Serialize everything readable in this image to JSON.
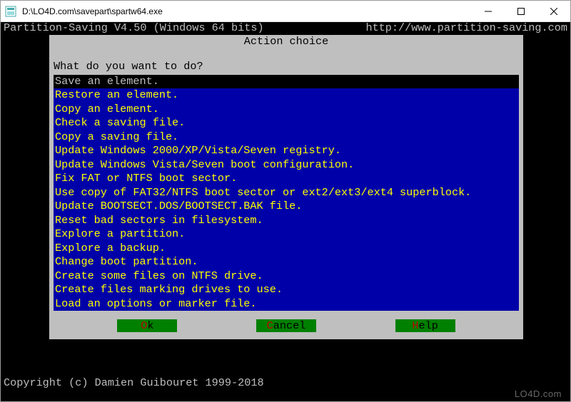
{
  "window": {
    "title": "D:\\LO4D.com\\savepart\\spartw64.exe"
  },
  "header": {
    "left": "Partition-Saving V4.50 (Windows 64 bits)",
    "right": "http://www.partition-saving.com"
  },
  "dialog": {
    "title": "Action choice",
    "prompt": "What do you want to do?",
    "items": [
      "Save an element.",
      "Restore an element.",
      "Copy an element.",
      "Check a saving file.",
      "Copy a saving file.",
      "Update Windows 2000/XP/Vista/Seven registry.",
      "Update Windows Vista/Seven boot configuration.",
      "Fix FAT or NTFS boot sector.",
      "Use copy of FAT32/NTFS boot sector or ext2/ext3/ext4 superblock.",
      "Update BOOTSECT.DOS/BOOTSECT.BAK file.",
      "Reset bad sectors in filesystem.",
      "Explore a partition.",
      "Explore a backup.",
      "Change boot partition.",
      "Create some files on NTFS drive.",
      "Create files marking drives to use.",
      "Load an options or marker file."
    ],
    "selectedIndex": 0,
    "buttons": {
      "ok": {
        "hotkey": "O",
        "rest": "k"
      },
      "cancel": {
        "hotkey": "C",
        "rest": "ancel"
      },
      "help": {
        "hotkey": "H",
        "rest": "elp"
      }
    }
  },
  "footer": "Copyright (c) Damien Guibouret 1999-2018",
  "watermark": "LO4D.com"
}
